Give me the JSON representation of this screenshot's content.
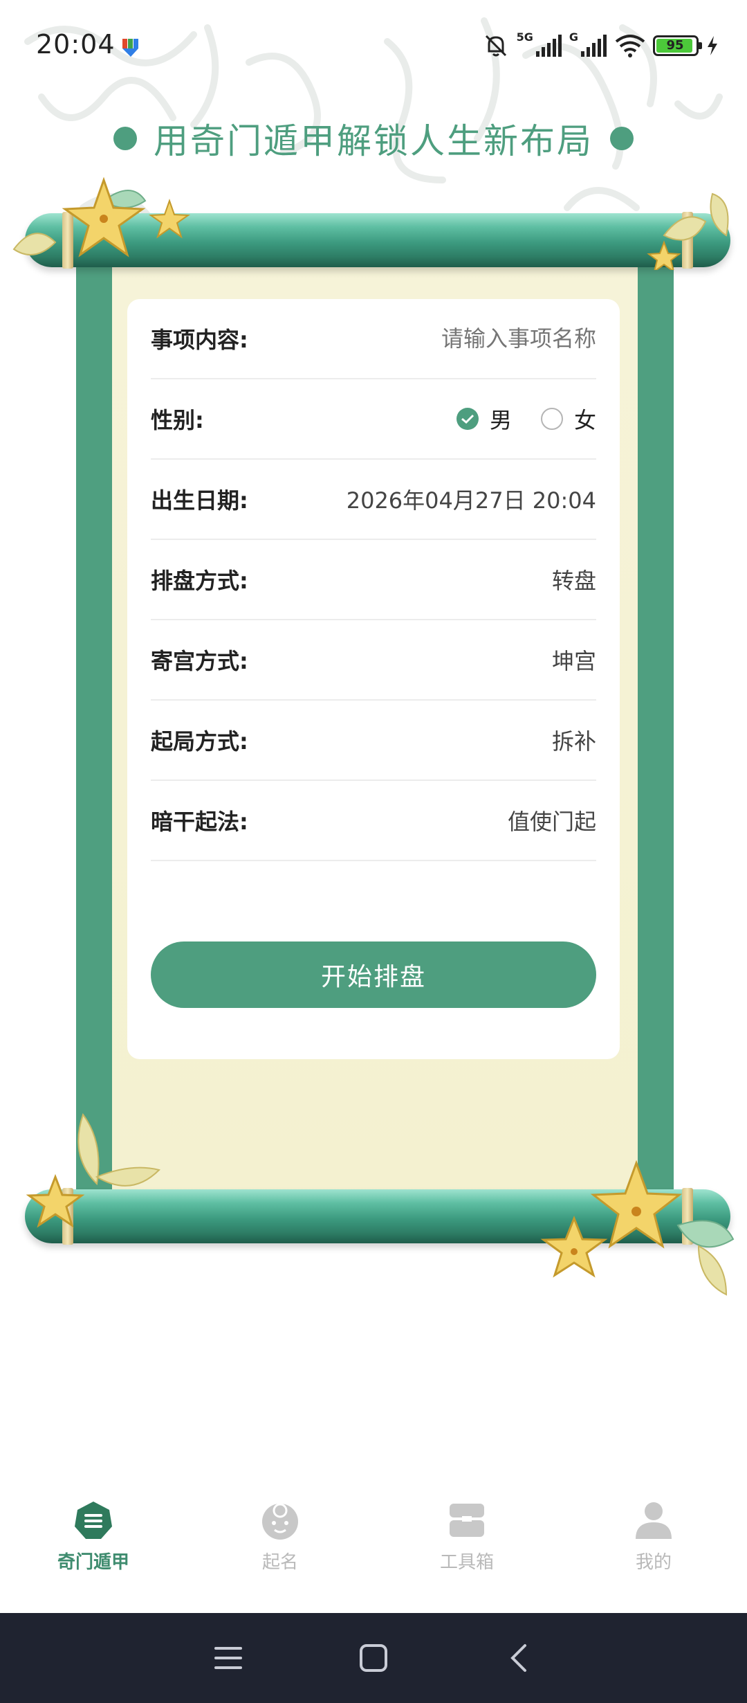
{
  "status_bar": {
    "time": "20:04",
    "network_1": "5G",
    "network_2": "G",
    "battery": "95"
  },
  "header": {
    "title": "用奇门遁甲解锁人生新布局"
  },
  "form": {
    "matter": {
      "label": "事项内容:",
      "placeholder": "请输入事项名称"
    },
    "gender": {
      "label": "性别:",
      "options": [
        "男",
        "女"
      ],
      "selected": "男"
    },
    "birth_date": {
      "label": "出生日期:",
      "value": "2026年04月27日 20:04"
    },
    "layout_method": {
      "label": "排盘方式:",
      "value": "转盘"
    },
    "palace_method": {
      "label": "寄宫方式:",
      "value": "坤宫"
    },
    "start_method": {
      "label": "起局方式:",
      "value": "拆补"
    },
    "hidden_stem": {
      "label": "暗干起法:",
      "value": "值使门起"
    },
    "submit_label": "开始排盘"
  },
  "bottom_nav": {
    "items": [
      {
        "label": "奇门遁甲",
        "icon": "qimen-icon",
        "active": true
      },
      {
        "label": "起名",
        "icon": "baby-face-icon",
        "active": false
      },
      {
        "label": "工具箱",
        "icon": "toolbox-icon",
        "active": false
      },
      {
        "label": "我的",
        "icon": "person-icon",
        "active": false
      }
    ]
  },
  "colors": {
    "accent": "#4e9e7f",
    "paper": "#f5f2d4",
    "system_nav": "#1f2330"
  }
}
